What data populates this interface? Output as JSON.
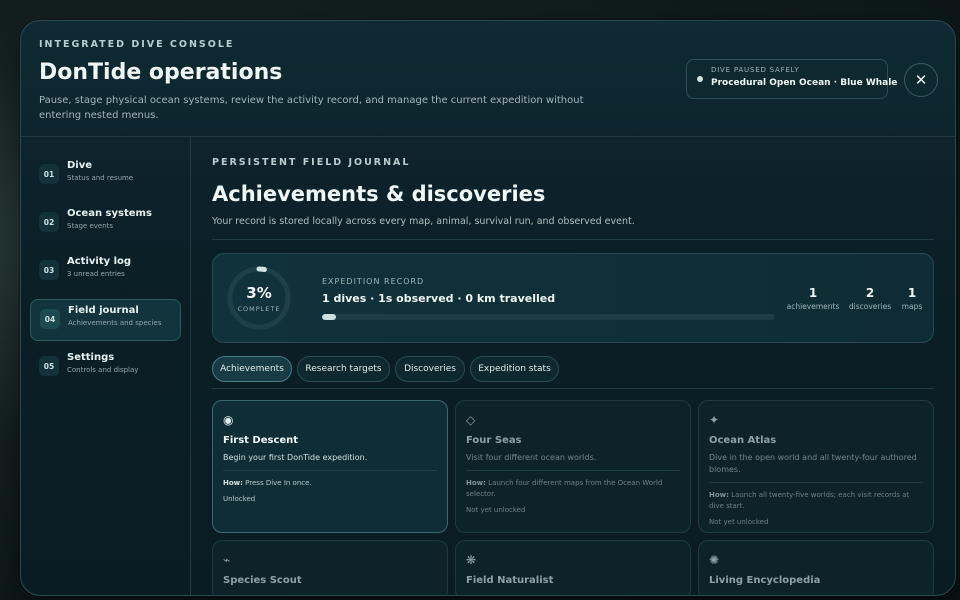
{
  "header": {
    "eyebrow": "INTEGRATED DIVE CONSOLE",
    "title": "DonTide operations",
    "subtitle": "Pause, stage physical ocean systems, review the activity record, and manage the current expedition without entering nested menus.",
    "status_label": "DIVE PAUSED SAFELY",
    "status_value": "Procedural Open Ocean · Blue Whale",
    "close_glyph": "✕"
  },
  "sidebar": {
    "items": [
      {
        "num": "01",
        "title": "Dive",
        "sub": "Status and resume"
      },
      {
        "num": "02",
        "title": "Ocean systems",
        "sub": "Stage events"
      },
      {
        "num": "03",
        "title": "Activity log",
        "sub": "3 unread entries"
      },
      {
        "num": "04",
        "title": "Field journal",
        "sub": "Achievements and species"
      },
      {
        "num": "05",
        "title": "Settings",
        "sub": "Controls and display"
      }
    ],
    "active_index": 3
  },
  "main": {
    "eyebrow": "PERSISTENT FIELD JOURNAL",
    "title": "Achievements & discoveries",
    "subtitle": "Your record is stored locally across every map, animal, survival run, and observed event."
  },
  "record": {
    "percent": "3%",
    "percent_value": 0.03,
    "complete_label": "COMPLETE",
    "label": "EXPEDITION RECORD",
    "summary": "1 dives · 1s observed · 0 km travelled",
    "progress": 0.03,
    "stats": [
      {
        "num": "1",
        "label": "achievements"
      },
      {
        "num": "2",
        "label": "discoveries"
      },
      {
        "num": "1",
        "label": "maps"
      }
    ]
  },
  "tabs": [
    {
      "label": "Achievements"
    },
    {
      "label": "Research targets"
    },
    {
      "label": "Discoveries"
    },
    {
      "label": "Expedition stats"
    }
  ],
  "cards": [
    {
      "icon": "◉",
      "title": "First Descent",
      "desc": "Begin your first DonTide expedition.",
      "how_label": "How:",
      "how": "Press Dive In once.",
      "state": "Unlocked"
    },
    {
      "icon": "◇",
      "title": "Four Seas",
      "desc": "Visit four different ocean worlds.",
      "how_label": "How:",
      "how": "Launch four different maps from the Ocean World selector.",
      "state": "Not yet unlocked"
    },
    {
      "icon": "✦",
      "title": "Ocean Atlas",
      "desc": "Dive in the open world and all twenty-four authored biomes.",
      "how_label": "How:",
      "how": "Launch all twenty-five worlds; each visit records at dive start.",
      "state": "Not yet unlocked"
    },
    {
      "icon": "⌁",
      "title": "Species Scout"
    },
    {
      "icon": "❋",
      "title": "Field Naturalist"
    },
    {
      "icon": "✺",
      "title": "Living Encyclopedia"
    }
  ]
}
